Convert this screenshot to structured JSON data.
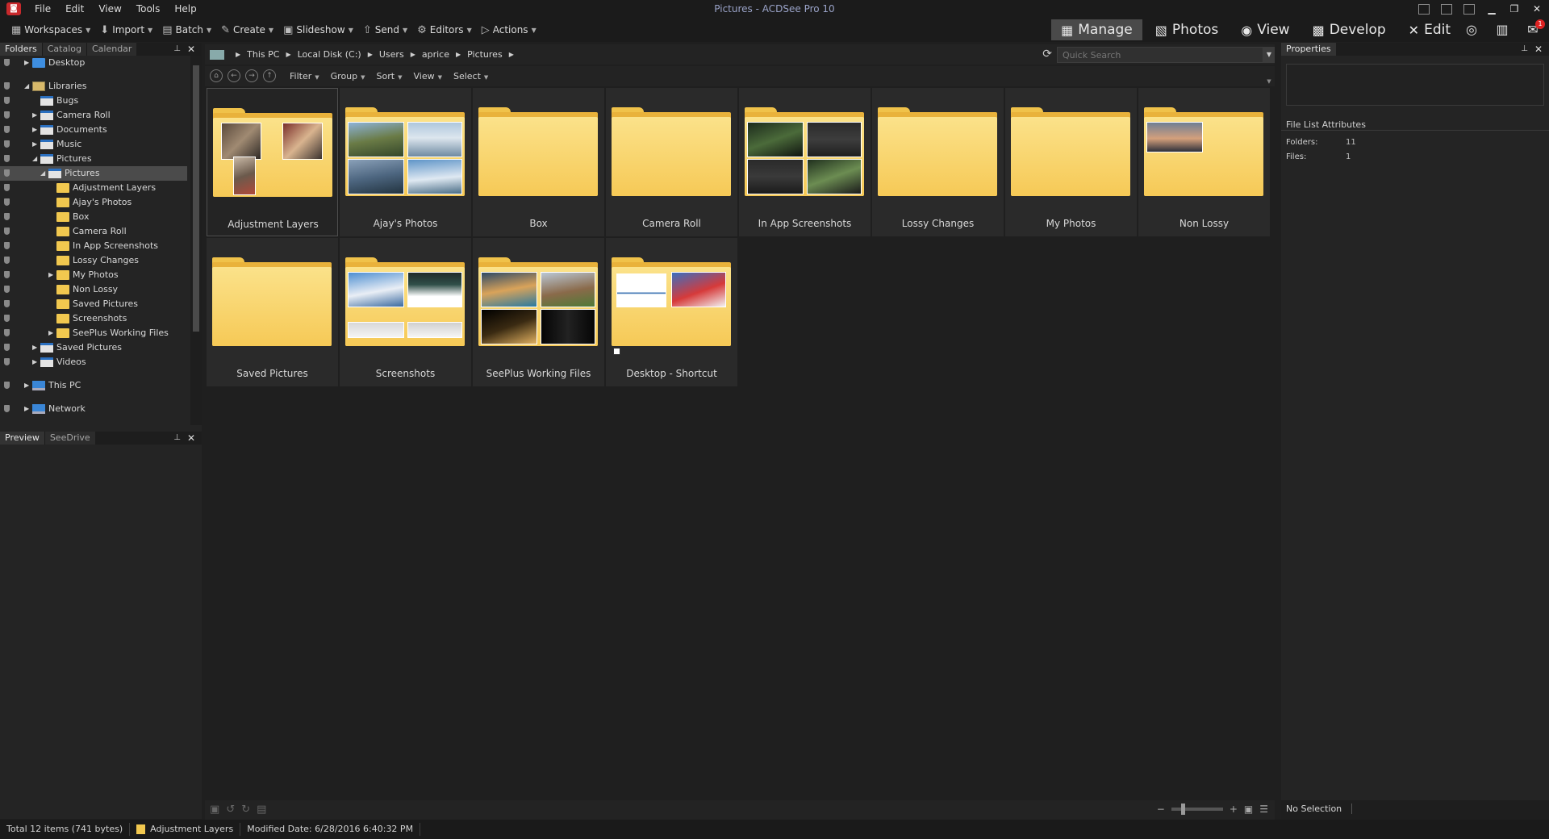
{
  "window": {
    "title": "Pictures - ACDSee Pro 10",
    "menu": [
      "File",
      "Edit",
      "View",
      "Tools",
      "Help"
    ]
  },
  "toolbar": {
    "tools": [
      {
        "label": "Workspaces",
        "icon": "workspaces-icon",
        "glyph": "▦"
      },
      {
        "label": "Import",
        "icon": "import-icon",
        "glyph": "⬇"
      },
      {
        "label": "Batch",
        "icon": "batch-icon",
        "glyph": "▤"
      },
      {
        "label": "Create",
        "icon": "create-icon",
        "glyph": "✎"
      },
      {
        "label": "Slideshow",
        "icon": "slideshow-icon",
        "glyph": "▣"
      },
      {
        "label": "Send",
        "icon": "send-icon",
        "glyph": "⇧"
      },
      {
        "label": "Editors",
        "icon": "editors-icon",
        "glyph": "⚙"
      },
      {
        "label": "Actions",
        "icon": "actions-icon",
        "glyph": "▷"
      }
    ],
    "modes": [
      {
        "label": "Manage",
        "icon": "manage-icon",
        "glyph": "▦",
        "active": true
      },
      {
        "label": "Photos",
        "icon": "photos-icon",
        "glyph": "▧",
        "active": false
      },
      {
        "label": "View",
        "icon": "view-icon",
        "glyph": "◉",
        "active": false
      },
      {
        "label": "Develop",
        "icon": "develop-icon",
        "glyph": "▩",
        "active": false
      },
      {
        "label": "Edit",
        "icon": "edit-icon",
        "glyph": "✕",
        "active": false
      }
    ],
    "notification_count": "1"
  },
  "left_panel": {
    "tabs": [
      "Folders",
      "Catalog",
      "Calendar"
    ],
    "tree": [
      {
        "label": "Desktop",
        "depth": 0,
        "arrow": "▶",
        "icon": "ic-blue",
        "sel": false
      },
      {
        "label": "Libraries",
        "depth": 0,
        "arrow": "◢",
        "icon": "ic-lib",
        "sel": false,
        "gap": true
      },
      {
        "label": "Bugs",
        "depth": 1,
        "arrow": "",
        "icon": "ic-doc",
        "sel": false
      },
      {
        "label": "Camera Roll",
        "depth": 1,
        "arrow": "▶",
        "icon": "ic-doc",
        "sel": false
      },
      {
        "label": "Documents",
        "depth": 1,
        "arrow": "▶",
        "icon": "ic-doc",
        "sel": false
      },
      {
        "label": "Music",
        "depth": 1,
        "arrow": "▶",
        "icon": "ic-doc",
        "sel": false
      },
      {
        "label": "Pictures",
        "depth": 1,
        "arrow": "◢",
        "icon": "ic-doc",
        "sel": false
      },
      {
        "label": "Pictures",
        "depth": 2,
        "arrow": "◢",
        "icon": "ic-doc",
        "sel": true
      },
      {
        "label": "Adjustment Layers",
        "depth": 3,
        "arrow": "",
        "icon": "ic-yellow",
        "sel": false
      },
      {
        "label": "Ajay's Photos",
        "depth": 3,
        "arrow": "",
        "icon": "ic-yellow",
        "sel": false
      },
      {
        "label": "Box",
        "depth": 3,
        "arrow": "",
        "icon": "ic-yellow",
        "sel": false
      },
      {
        "label": "Camera Roll",
        "depth": 3,
        "arrow": "",
        "icon": "ic-yellow",
        "sel": false
      },
      {
        "label": "In App Screenshots",
        "depth": 3,
        "arrow": "",
        "icon": "ic-yellow",
        "sel": false
      },
      {
        "label": "Lossy Changes",
        "depth": 3,
        "arrow": "",
        "icon": "ic-yellow",
        "sel": false
      },
      {
        "label": "My Photos",
        "depth": 3,
        "arrow": "▶",
        "icon": "ic-yellow",
        "sel": false
      },
      {
        "label": "Non Lossy",
        "depth": 3,
        "arrow": "",
        "icon": "ic-yellow",
        "sel": false
      },
      {
        "label": "Saved Pictures",
        "depth": 3,
        "arrow": "",
        "icon": "ic-yellow",
        "sel": false
      },
      {
        "label": "Screenshots",
        "depth": 3,
        "arrow": "",
        "icon": "ic-yellow",
        "sel": false
      },
      {
        "label": "SeePlus Working Files",
        "depth": 3,
        "arrow": "▶",
        "icon": "ic-yellow",
        "sel": false
      },
      {
        "label": "Saved Pictures",
        "depth": 1,
        "arrow": "▶",
        "icon": "ic-doc",
        "sel": false
      },
      {
        "label": "Videos",
        "depth": 1,
        "arrow": "▶",
        "icon": "ic-doc",
        "sel": false
      },
      {
        "label": "This PC",
        "depth": 0,
        "arrow": "▶",
        "icon": "ic-pc",
        "sel": false,
        "gap": true
      },
      {
        "label": "Network",
        "depth": 0,
        "arrow": "▶",
        "icon": "ic-pc",
        "sel": false,
        "gap": true
      }
    ],
    "lower_tabs": [
      "Preview",
      "SeeDrive"
    ]
  },
  "path_bar": {
    "crumbs": [
      "This PC",
      "Local Disk (C:)",
      "Users",
      "aprice",
      "Pictures"
    ],
    "search_placeholder": "Quick Search"
  },
  "list_toolbar": {
    "menus": [
      "Filter",
      "Group",
      "Sort",
      "View",
      "Select"
    ]
  },
  "files": [
    {
      "name": "Adjustment Layers",
      "thumbs": "adj",
      "selected": true
    },
    {
      "name": "Ajay's Photos",
      "thumbs": "ajay",
      "selected": false
    },
    {
      "name": "Box",
      "thumbs": "none",
      "selected": false
    },
    {
      "name": "Camera Roll",
      "thumbs": "none",
      "selected": false
    },
    {
      "name": "In App Screenshots",
      "thumbs": "inapp",
      "selected": false
    },
    {
      "name": "Lossy Changes",
      "thumbs": "none",
      "selected": false
    },
    {
      "name": "My Photos",
      "thumbs": "none",
      "selected": false
    },
    {
      "name": "Non Lossy",
      "thumbs": "nonlossy",
      "selected": false
    },
    {
      "name": "Saved Pictures",
      "thumbs": "none",
      "selected": false
    },
    {
      "name": "Screenshots",
      "thumbs": "shots",
      "selected": false
    },
    {
      "name": "SeePlus Working Files",
      "thumbs": "seeplus",
      "selected": false
    },
    {
      "name": "Desktop - Shortcut",
      "thumbs": "shortcut",
      "selected": false
    }
  ],
  "properties": {
    "title": "Properties",
    "section": "File List Attributes",
    "rows": [
      {
        "label": "Folders:",
        "value": "11"
      },
      {
        "label": "Files:",
        "value": "1"
      }
    ],
    "footer": "No Selection"
  },
  "status": {
    "total": "Total 12 items  (741 bytes)",
    "current": "Adjustment Layers",
    "modified": "Modified Date: 6/28/2016 6:40:32 PM"
  }
}
